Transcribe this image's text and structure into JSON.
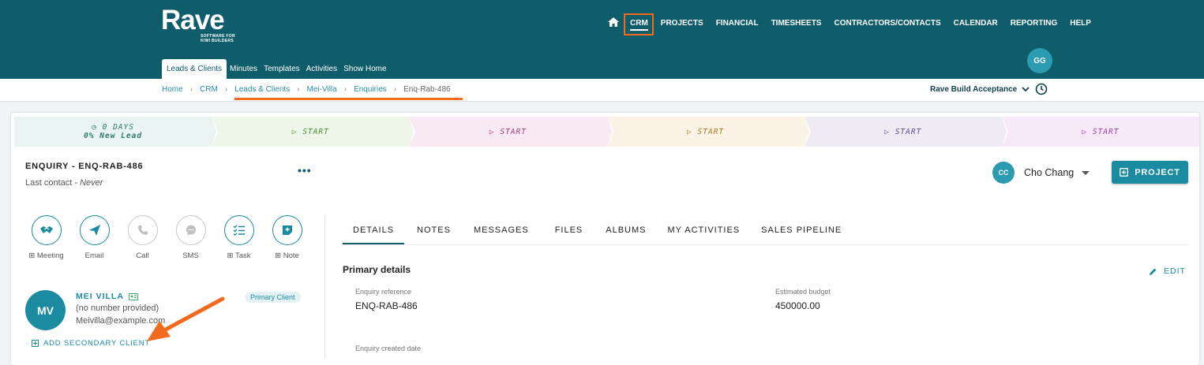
{
  "brand": {
    "name": "Rave",
    "tagline": "SOFTWARE FOR KIWI BUILDERS"
  },
  "nav": {
    "items": [
      "CRM",
      "PROJECTS",
      "FINANCIAL",
      "TIMESHEETS",
      "CONTRACTORS/CONTACTS",
      "CALENDAR",
      "REPORTING",
      "HELP"
    ],
    "active": "CRM"
  },
  "subnav": {
    "items": [
      "Leads & Clients",
      "Minutes",
      "Templates",
      "Activities",
      "Show Home"
    ],
    "active": "Leads & Clients"
  },
  "user": {
    "initials": "GG"
  },
  "breadcrumb": [
    "Home",
    "CRM",
    "Leads & Clients",
    "Mei-Villa",
    "Enquiries",
    "Enq-Rab-486"
  ],
  "company": {
    "name": "Rave Build Acceptance"
  },
  "pipeline": {
    "stages": [
      {
        "line1": "0 DAYS",
        "line2": "0% New Lead",
        "color": "#e9f3f1",
        "text": "#2e7a6a"
      },
      {
        "line1": "START",
        "color": "#eef6e9",
        "text": "#4f8a2a"
      },
      {
        "line1": "START",
        "color": "#f8e9f2",
        "text": "#a13b7a"
      },
      {
        "line1": "START",
        "color": "#fbf4e6",
        "text": "#a7781f"
      },
      {
        "line1": "START",
        "color": "#eeebf4",
        "text": "#5b4a8c"
      },
      {
        "line1": "START",
        "color": "#f7e9f8",
        "text": "#9a3fa6"
      }
    ]
  },
  "enquiry": {
    "title": "ENQUIRY - ENQ-RAB-486",
    "last_contact_label": "Last contact - ",
    "last_contact_value": "Never"
  },
  "owner": {
    "initials": "CC",
    "name": "Cho Chang"
  },
  "project_button": "PROJECT",
  "actions": [
    {
      "label": "Meeting",
      "icon": "handshake-icon",
      "plus": true,
      "enabled": true
    },
    {
      "label": "Email",
      "icon": "send-icon",
      "plus": false,
      "enabled": true
    },
    {
      "label": "Call",
      "icon": "phone-icon",
      "plus": false,
      "enabled": false
    },
    {
      "label": "SMS",
      "icon": "chat-icon",
      "plus": false,
      "enabled": false
    },
    {
      "label": "Task",
      "icon": "checklist-icon",
      "plus": true,
      "enabled": true
    },
    {
      "label": "Note",
      "icon": "note-icon",
      "plus": true,
      "enabled": true
    }
  ],
  "tabs": {
    "items": [
      "DETAILS",
      "NOTES",
      "MESSAGES",
      "FILES",
      "ALBUMS",
      "MY ACTIVITIES",
      "SALES PIPELINE"
    ],
    "active": "DETAILS"
  },
  "details": {
    "section_title": "Primary details",
    "edit_label": "EDIT",
    "fields": [
      {
        "label": "Enquiry reference",
        "value": "ENQ-RAB-486"
      },
      {
        "label": "Estimated budget",
        "value": "450000.00"
      },
      {
        "label": "Enquiry created date",
        "value": ""
      }
    ]
  },
  "client": {
    "initials": "MV",
    "name": "MEI VILLA",
    "phone": "(no number provided)",
    "email": "Meivilla@example.com",
    "badge": "Primary Client",
    "add_secondary": "ADD SECONDARY CLIENT"
  },
  "colors": {
    "header": "#0f5c6b",
    "accent": "#1a8ba0",
    "highlight": "#f26b1d"
  }
}
